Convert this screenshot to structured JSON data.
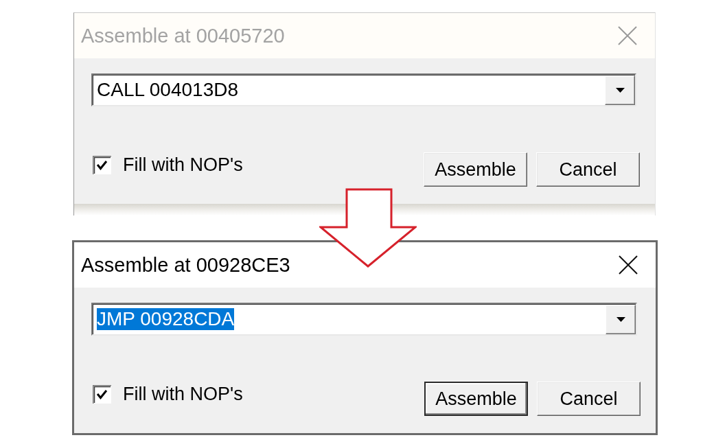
{
  "dialogs": [
    {
      "title": "Assemble at 00405720",
      "active": false,
      "command": {
        "value": "CALL 004013D8",
        "text_selected": false
      },
      "fill_with_nops": {
        "label": "Fill with NOP's",
        "checked": true
      },
      "buttons": [
        {
          "label": "Assemble",
          "default": false
        },
        {
          "label": "Cancel",
          "default": false
        }
      ]
    },
    {
      "title": "Assemble at 00928CE3",
      "active": true,
      "command": {
        "value": "JMP 00928CDA",
        "text_selected": true
      },
      "fill_with_nops": {
        "label": "Fill with NOP's",
        "checked": true
      },
      "buttons": [
        {
          "label": "Assemble",
          "default": true
        },
        {
          "label": "Cancel",
          "default": false
        }
      ]
    }
  ]
}
